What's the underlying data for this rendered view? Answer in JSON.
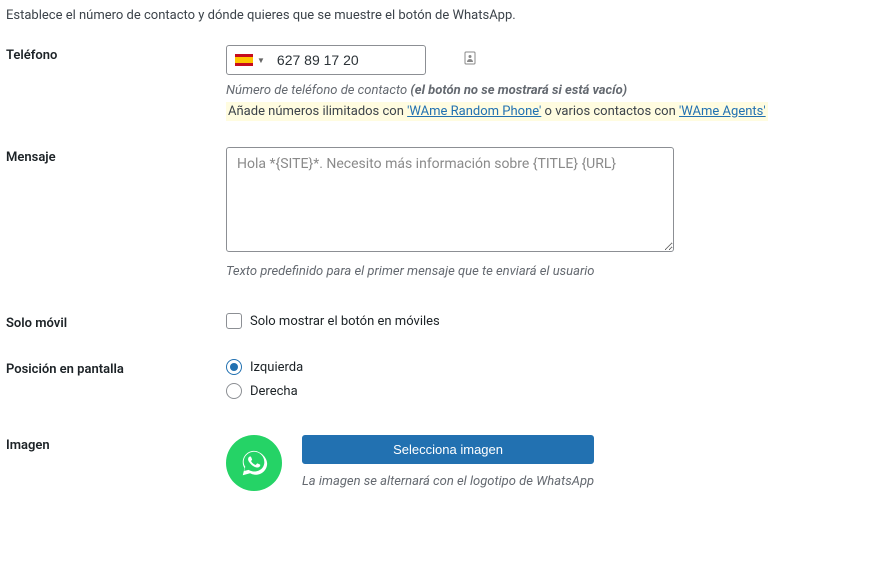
{
  "intro": "Establece el número de contacto y dónde quieres que se muestre el botón de WhatsApp.",
  "phone": {
    "label": "Teléfono",
    "value": "627 89 17 20",
    "help_prefix": "Número de teléfono de contacto ",
    "help_bold": "(el botón no se mostrará si está vacío)",
    "promo_pre": "Añade números ilimitados con ",
    "promo_link1": "'WAme Random Phone'",
    "promo_mid": " o varios contactos con ",
    "promo_link2": "'WAme Agents'"
  },
  "message": {
    "label": "Mensaje",
    "placeholder": "Hola *{SITE}*. Necesito más información sobre {TITLE} {URL}",
    "help": "Texto predefinido para el primer mensaje que te enviará el usuario"
  },
  "mobile": {
    "label": "Solo móvil",
    "checkbox_label": "Solo mostrar el botón en móviles"
  },
  "position": {
    "label": "Posición en pantalla",
    "left": "Izquierda",
    "right": "Derecha"
  },
  "image": {
    "label": "Imagen",
    "button": "Selecciona imagen",
    "help": "La imagen se alternará con el logotipo de WhatsApp"
  }
}
